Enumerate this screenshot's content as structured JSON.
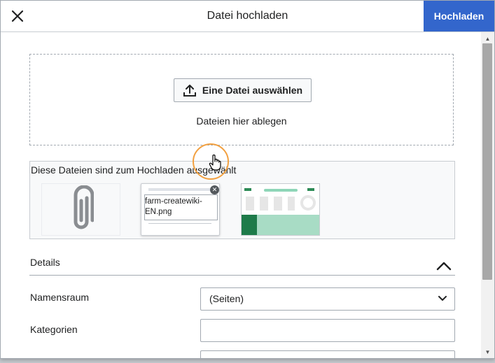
{
  "header": {
    "title": "Datei hochladen",
    "upload_label": "Hochladen"
  },
  "dropzone": {
    "select_button_label": "Eine Datei auswählen",
    "hint": "Dateien hier ablegen"
  },
  "selected_files": {
    "heading": "Diese Dateien sind zum Hochladen ausgewählt",
    "tooltip_filename_line1": "farm-createwiki-",
    "tooltip_filename_line2": "EN.png"
  },
  "details": {
    "label": "Details",
    "namespace_label": "Namensraum",
    "namespace_value": "(Seiten)",
    "categories_label": "Kategorien"
  },
  "colors": {
    "primary": "#3366cc",
    "highlight_ring": "#f2a040",
    "border": "#a2a9b1"
  },
  "icons": [
    "close-icon",
    "upload-icon",
    "paperclip-icon",
    "chevron-up-icon",
    "chevron-down-icon",
    "remove-icon",
    "hand-cursor-icon"
  ]
}
